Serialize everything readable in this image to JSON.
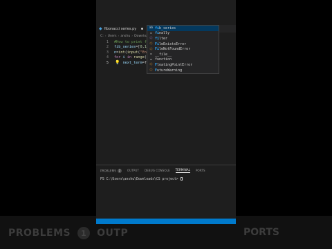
{
  "tab": {
    "filename": "fibonacci series.py"
  },
  "breadcrumb": [
    "C:",
    "Users",
    "anshu",
    "Downloads",
    "fibonacci series.py",
    "..."
  ],
  "editor": {
    "lines": [
      {
        "num": "1",
        "tokens": [
          {
            "t": "comment",
            "v": "#How to print fibonacci series"
          }
        ]
      },
      {
        "num": "2",
        "tokens": [
          {
            "t": "var",
            "v": "fib_series"
          },
          {
            "t": "plain",
            "v": "=["
          },
          {
            "t": "num",
            "v": "0"
          },
          {
            "t": "plain",
            "v": ","
          },
          {
            "t": "num",
            "v": "1"
          },
          {
            "t": "plain",
            "v": "]"
          }
        ]
      },
      {
        "num": "3",
        "tokens": [
          {
            "t": "var",
            "v": "n"
          },
          {
            "t": "plain",
            "v": "="
          },
          {
            "t": "fn",
            "v": "int"
          },
          {
            "t": "plain",
            "v": "("
          },
          {
            "t": "fn",
            "v": "input"
          },
          {
            "t": "plain",
            "v": "("
          },
          {
            "t": "str",
            "v": "\"Enter number of terms :\""
          },
          {
            "t": "plain",
            "v": "))"
          }
        ]
      },
      {
        "num": "4",
        "tokens": [
          {
            "t": "kw",
            "v": "for"
          },
          {
            "t": "plain",
            "v": " "
          },
          {
            "t": "var",
            "v": "i"
          },
          {
            "t": "plain",
            "v": " "
          },
          {
            "t": "kw",
            "v": "in"
          },
          {
            "t": "plain",
            "v": " "
          },
          {
            "t": "fn",
            "v": "range"
          },
          {
            "t": "plain",
            "v": "("
          },
          {
            "t": "var",
            "v": "n"
          },
          {
            "t": "plain",
            "v": "-"
          },
          {
            "t": "num",
            "v": "1"
          },
          {
            "t": "plain",
            "v": "):"
          }
        ]
      },
      {
        "num": "5",
        "tokens": [
          {
            "t": "plain",
            "v": "    "
          },
          {
            "t": "var",
            "v": "next_term"
          },
          {
            "t": "plain",
            "v": "=fi"
          }
        ]
      }
    ]
  },
  "suggestions": [
    {
      "icon": "kw",
      "glyph": "ab",
      "match": "fi",
      "rest": "b_series",
      "selected": true
    },
    {
      "icon": "kw",
      "glyph": "▭",
      "match": "fi",
      "rest": "nally"
    },
    {
      "icon": "fn",
      "glyph": "⬡",
      "match": "fi",
      "rest": "lter"
    },
    {
      "icon": "cls",
      "glyph": "⬡",
      "match": "Fi",
      "rest": "leExistsError"
    },
    {
      "icon": "cls",
      "glyph": "⬡",
      "match": "Fi",
      "rest": "leNotFoundError"
    },
    {
      "icon": "kw",
      "glyph": "▭",
      "match": "",
      "rest": "__file__"
    },
    {
      "icon": "kw",
      "glyph": "▭",
      "match": "",
      "rest": "function"
    },
    {
      "icon": "cls",
      "glyph": "⬡",
      "match": "F",
      "rest": "loatingPointError"
    },
    {
      "icon": "cls",
      "glyph": "⬡",
      "match": "F",
      "rest": "utureWarning"
    }
  ],
  "panel": {
    "tabs": [
      {
        "label": "PROBLEMS",
        "badge": "2",
        "active": false
      },
      {
        "label": "OUTPUT",
        "active": false
      },
      {
        "label": "DEBUG CONSOLE",
        "active": false
      },
      {
        "label": "TERMINAL",
        "active": true
      },
      {
        "label": "PORTS",
        "active": false
      }
    ],
    "terminal_prompt": "PS C:\\Users\\anshu\\Downloads\\CS project> "
  },
  "bleed": {
    "problems_label": "PROBLEMS",
    "problems_badge": "1",
    "output_label": "OUTP",
    "ports_label": "PORTS"
  },
  "colors": {
    "editor_bg": "#1e1e1e",
    "status_bar": "#007acc",
    "selection": "#04395e"
  }
}
